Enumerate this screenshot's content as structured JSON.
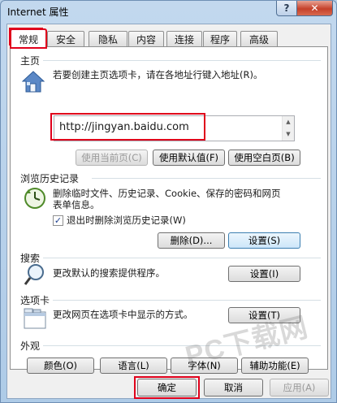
{
  "window": {
    "title": "Internet 属性",
    "help_label": "?",
    "close_label": "✕"
  },
  "tabs": [
    {
      "label": "常规",
      "active": true
    },
    {
      "label": "安全",
      "active": false
    },
    {
      "label": "隐私",
      "active": false
    },
    {
      "label": "内容",
      "active": false
    },
    {
      "label": "连接",
      "active": false
    },
    {
      "label": "程序",
      "active": false
    },
    {
      "label": "高级",
      "active": false
    }
  ],
  "homepage": {
    "group_label": "主页",
    "description": "若要创建主页选项卡，请在各地址行键入地址(R)。",
    "address_value": "http://jingyan.baidu.com",
    "use_current_label": "使用当前页(C)",
    "use_default_label": "使用默认值(F)",
    "use_blank_label": "使用空白页(B)"
  },
  "history": {
    "group_label": "浏览历史记录",
    "description_line1": "删除临时文件、历史记录、Cookie、保存的密码和网页",
    "description_line2": "表单信息。",
    "checkbox_label": "退出时删除浏览历史记录(W)",
    "checkbox_checked": true,
    "delete_label": "删除(D)...",
    "settings_label": "设置(S)"
  },
  "search": {
    "group_label": "搜索",
    "description": "更改默认的搜索提供程序。",
    "settings_label": "设置(I)"
  },
  "tabs_section": {
    "group_label": "选项卡",
    "description": "更改网页在选项卡中显示的方式。",
    "settings_label": "设置(T)"
  },
  "appearance": {
    "group_label": "外观",
    "colors_label": "颜色(O)",
    "languages_label": "语言(L)",
    "fonts_label": "字体(N)",
    "accessibility_label": "辅助功能(E)"
  },
  "footer": {
    "ok_label": "确定",
    "cancel_label": "取消",
    "apply_label": "应用(A)"
  },
  "watermark": {
    "text": "PC下载网"
  },
  "colors": {
    "highlight_red": "#e0001b",
    "titlebar_blue": "#b9d1ea"
  }
}
